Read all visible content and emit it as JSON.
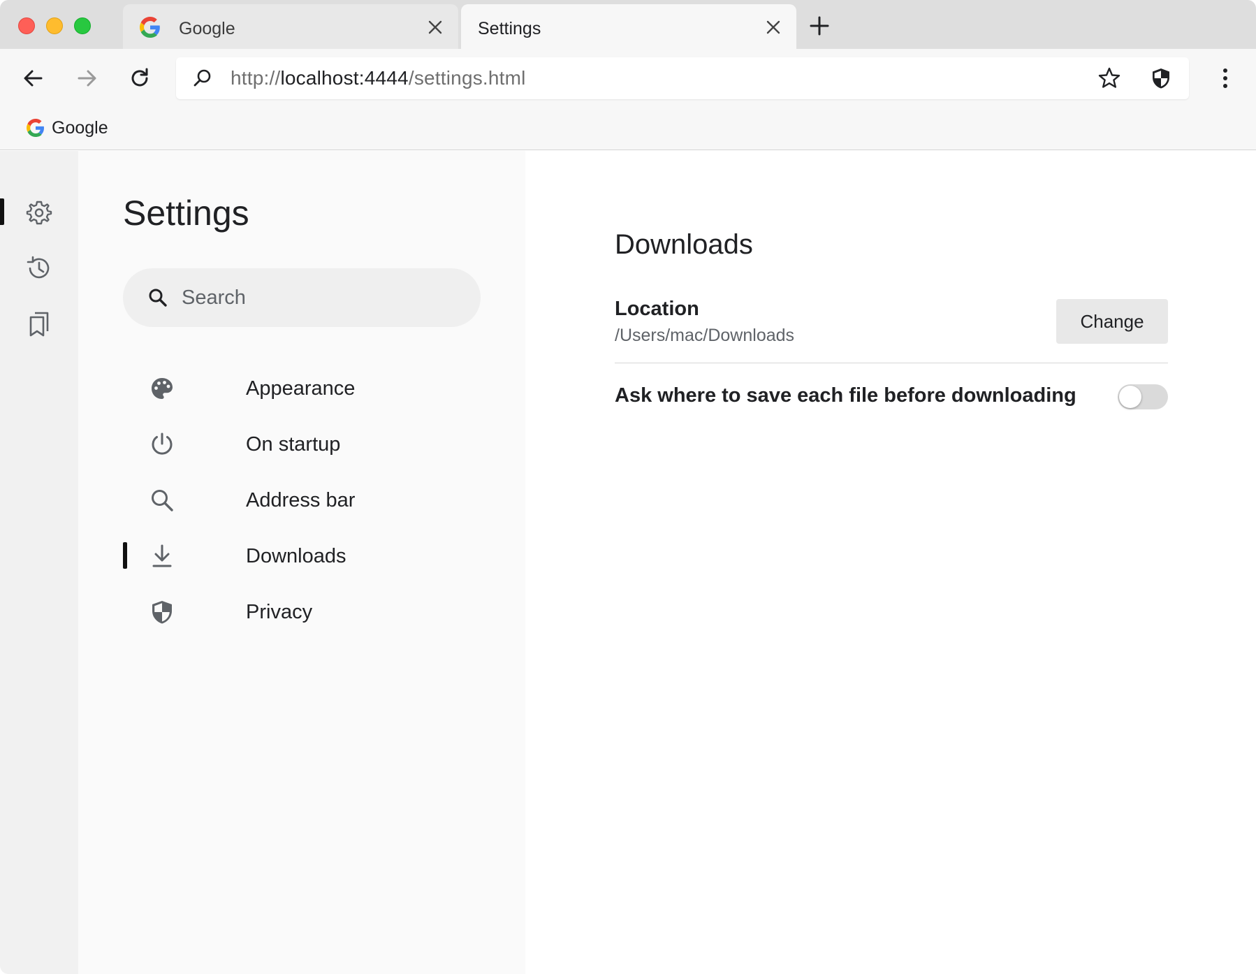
{
  "browser": {
    "tabs": [
      {
        "title": "Google",
        "active": false,
        "favicon": "google-logo"
      },
      {
        "title": "Settings",
        "active": true
      }
    ],
    "address": {
      "scheme": "http://",
      "host": "localhost:4444",
      "path": "/settings.html"
    },
    "bookmarks": [
      {
        "label": "Google",
        "favicon": "google-logo"
      }
    ]
  },
  "rail": {
    "items": [
      "gear-icon",
      "history-icon",
      "bookmarks-icon"
    ],
    "active_index": 0
  },
  "sidebar": {
    "title": "Settings",
    "search_placeholder": "Search",
    "items": [
      {
        "label": "Appearance",
        "icon": "palette-icon"
      },
      {
        "label": "On startup",
        "icon": "power-icon"
      },
      {
        "label": "Address bar",
        "icon": "search-icon"
      },
      {
        "label": "Downloads",
        "icon": "download-icon",
        "active": true
      },
      {
        "label": "Privacy",
        "icon": "shield-icon"
      }
    ]
  },
  "content": {
    "section_title": "Downloads",
    "location_label": "Location",
    "location_path": "/Users/mac/Downloads",
    "change_button": "Change",
    "ask_label": "Ask where to save each file before downloading",
    "ask_enabled": false
  }
}
